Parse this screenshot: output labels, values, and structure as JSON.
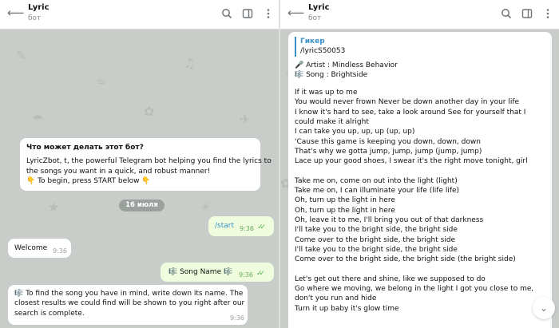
{
  "left_chat": {
    "header": {
      "title": "Lyric",
      "subtitle": "бот"
    },
    "bot_info": {
      "title": "Что может делать этот бот?",
      "lines": [
        "LyricZbot, t, the powerful Telegram bot helping you find the lyrics to",
        "the songs you want in a quick, and robust manner!",
        "👇 To begin, press START below 👇"
      ]
    },
    "date_badge": "16 июля",
    "messages": [
      {
        "text": "/start",
        "time": "9:36"
      },
      {
        "text": "Welcome",
        "time": "9:36"
      },
      {
        "text": "🎼 Song Name 🎼",
        "time": "9:36"
      },
      {
        "lines": [
          "🎼 To find the song you have in mind, write down its name. The",
          "closest results we could find will be shown to you right after our",
          "search is complete."
        ],
        "time": "9:36"
      }
    ]
  },
  "right_chat": {
    "header": {
      "title": "Lyric",
      "subtitle": "бот"
    },
    "reply": {
      "author": "Гикер",
      "command": "/lyricS50053"
    },
    "artist": "🎤 Artist : Mindless Behavior",
    "song": "🎼 Song : Brightside",
    "lyrics": [
      "If it was up to me",
      "You would never frown Never be down another day in your life",
      "I know it's hard to see, take a look around See for yourself that I",
      "could make it alright",
      "I can take you up, up, up (up, up)",
      "'Cause this game is keeping you down, down, down",
      "That's why we gotta jump, jump, jump (jump, jump)",
      "Lace up your good shoes, I swear it's the right move tonight, girl",
      "",
      "Take me on, come on out into the light (light)",
      "Take me on, I can illuminate your life (life life)",
      "Oh, turn up the light in here",
      "Oh, turn up the light in here",
      "Oh, leave it to me, I'll bring you out of that darkness",
      "I'll take you to the bright side, the bright side",
      "Come over to the bright side, the bright side",
      "I'll take you to the bright side, the bright side",
      "Come over to the bright side, the bright side (the bright side)",
      "",
      "Let's get out there and shine, like we supposed to do",
      "Go where we moving, we belong in the light I got you close to me,",
      "don't you run and hide",
      "Turn it up baby it's glow time"
    ]
  },
  "icons": [
    "back-arrow-icon",
    "search-icon",
    "sidebar-toggle-icon",
    "more-vertical-icon",
    "double-check-icon",
    "scroll-down-icon"
  ],
  "colors": {
    "outgoing_bubble": "#effdde",
    "link": "#3a90c9",
    "check": "#4fae4e",
    "background": "#c9cdca"
  }
}
